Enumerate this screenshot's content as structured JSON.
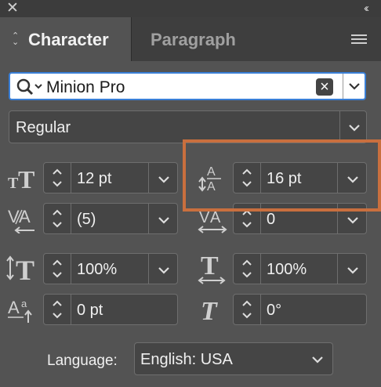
{
  "window": {
    "close_glyph": "✕",
    "collapse_glyph": "‹‹"
  },
  "tabs": {
    "active": "Character",
    "inactive": "Paragraph"
  },
  "font": {
    "family": "Minion Pro",
    "style": "Regular"
  },
  "fields": {
    "font_size": "12 pt",
    "leading": "16 pt",
    "kerning": "(5)",
    "tracking": "0",
    "vertical_scale": "100%",
    "horizontal_scale": "100%",
    "baseline_shift": "0 pt",
    "character_rotation": "0°"
  },
  "language": {
    "label": "Language:",
    "value": "English: USA"
  },
  "colors": {
    "highlight": "#c96f3e",
    "focus": "#3a7fd6",
    "panel": "#535353"
  }
}
